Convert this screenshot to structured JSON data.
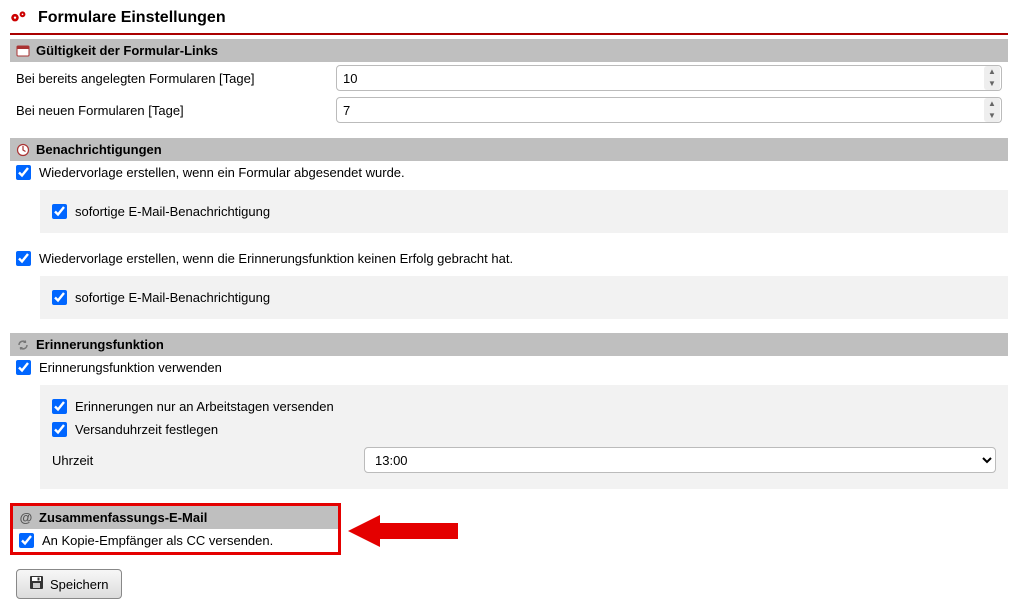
{
  "page": {
    "title": "Formulare Einstellungen"
  },
  "validity": {
    "heading": "Gültigkeit der Formular-Links",
    "existing_label": "Bei bereits angelegten Formularen [Tage]",
    "existing_value": "10",
    "new_label": "Bei neuen Formularen [Tage]",
    "new_value": "7"
  },
  "notifications": {
    "heading": "Benachrichtigungen",
    "resubmit_on_send": "Wiedervorlage erstellen, wenn ein Formular abgesendet wurde.",
    "immediate_email": "sofortige E-Mail-Benachrichtigung",
    "resubmit_on_reminder_fail": "Wiedervorlage erstellen, wenn die Erinnerungsfunktion keinen Erfolg gebracht hat."
  },
  "reminder": {
    "heading": "Erinnerungsfunktion",
    "use_reminder": "Erinnerungsfunktion verwenden",
    "workdays_only": "Erinnerungen nur an Arbeitstagen versenden",
    "set_send_time": "Versanduhrzeit festlegen",
    "time_label": "Uhrzeit",
    "time_value": "13:00"
  },
  "summary": {
    "heading": "Zusammenfassungs-E-Mail",
    "cc_label": "An Kopie-Empfänger als CC versenden."
  },
  "actions": {
    "save": "Speichern"
  }
}
